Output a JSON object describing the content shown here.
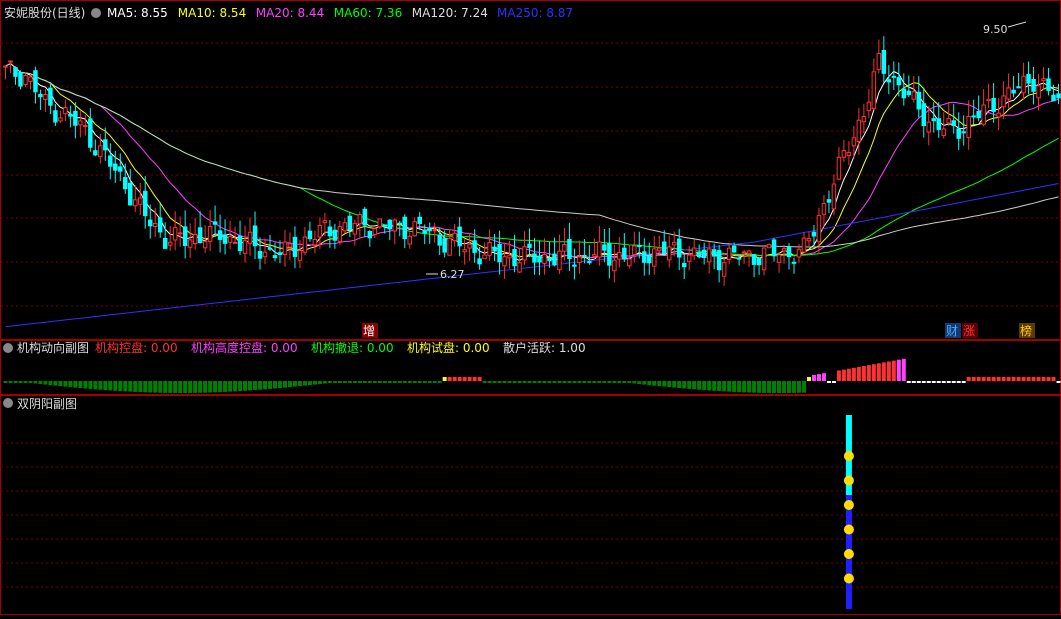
{
  "header": {
    "title": "安妮股份(日线)",
    "ma": [
      {
        "label": "MA5: 8.55",
        "color": "#ffffff"
      },
      {
        "label": "MA10: 8.54",
        "color": "#ffff00"
      },
      {
        "label": "MA20: 8.44",
        "color": "#ff40ff"
      },
      {
        "label": "MA60: 7.36",
        "color": "#00ff00"
      },
      {
        "label": "MA120: 7.24",
        "color": "#dddddd"
      },
      {
        "label": "MA250: 8.87",
        "color": "#3030ff"
      }
    ]
  },
  "annotations": {
    "high_label": "9.50",
    "low_label": "6.27",
    "tags": [
      {
        "text": "增",
        "color": "#ffffff"
      },
      {
        "text": "财",
        "color": "#4aa8ff"
      },
      {
        "text": "涨",
        "color": "#ff3030"
      },
      {
        "text": "榜",
        "color": "#ffcc00"
      }
    ]
  },
  "sub1": {
    "title": "机构动向副图",
    "items": [
      {
        "label": "机构控盘: 0.00",
        "color": "#ff3030"
      },
      {
        "label": "机构高度控盘: 0.00",
        "color": "#ff40ff"
      },
      {
        "label": "机构撤退: 0.00",
        "color": "#00ff00"
      },
      {
        "label": "机构试盘: 0.00",
        "color": "#ffff00"
      },
      {
        "label": "散户活跃: 1.00",
        "color": "#dddddd"
      }
    ]
  },
  "sub2": {
    "title": "双阴阳副图"
  },
  "colors": {
    "up": "#ff3030",
    "down": "#00ffff",
    "grid": "#7a0000",
    "border": "#a00000"
  },
  "chart_data": {
    "type": "candlestick",
    "count": 116,
    "price_range": [
      5.2,
      9.8
    ],
    "closes_keypoints": [
      [
        0,
        9.1
      ],
      [
        4,
        9.05
      ],
      [
        8,
        8.6
      ],
      [
        12,
        8.45
      ],
      [
        16,
        8.2
      ],
      [
        20,
        7.8
      ],
      [
        24,
        7.4
      ],
      [
        28,
        6.9
      ],
      [
        32,
        6.6
      ],
      [
        36,
        6.55
      ],
      [
        40,
        6.65
      ],
      [
        44,
        6.6
      ],
      [
        48,
        6.5
      ],
      [
        52,
        6.4
      ],
      [
        56,
        6.35
      ],
      [
        60,
        6.55
      ],
      [
        64,
        6.7
      ],
      [
        68,
        6.75
      ],
      [
        72,
        6.8
      ],
      [
        76,
        6.75
      ],
      [
        80,
        6.75
      ],
      [
        84,
        6.7
      ],
      [
        88,
        6.55
      ],
      [
        92,
        6.45
      ],
      [
        96,
        6.35
      ],
      [
        100,
        6.3
      ],
      [
        104,
        6.3
      ],
      [
        108,
        6.3
      ],
      [
        112,
        6.3
      ],
      [
        116,
        6.3
      ],
      [
        120,
        6.35
      ],
      [
        124,
        6.3
      ],
      [
        128,
        6.35
      ],
      [
        132,
        6.4
      ],
      [
        136,
        6.35
      ],
      [
        140,
        6.3
      ],
      [
        144,
        6.3
      ],
      [
        148,
        6.32
      ],
      [
        152,
        6.34
      ],
      [
        156,
        6.36
      ],
      [
        160,
        6.4
      ],
      [
        162,
        6.7
      ],
      [
        164,
        7.1
      ],
      [
        168,
        7.8
      ],
      [
        172,
        8.5
      ],
      [
        175,
        9.2
      ],
      [
        178,
        9.0
      ],
      [
        182,
        8.6
      ],
      [
        186,
        8.3
      ],
      [
        190,
        8.2
      ],
      [
        194,
        8.4
      ],
      [
        198,
        8.6
      ],
      [
        202,
        8.8
      ],
      [
        206,
        9.0
      ],
      [
        210,
        8.7
      ],
      [
        212,
        8.55
      ]
    ],
    "sub1_bars": {
      "colors_by_range": [
        {
          "range": [
            0,
            87
          ],
          "color": "#008000"
        },
        {
          "range": [
            88,
            88
          ],
          "color": "#ffff00"
        },
        {
          "range": [
            89,
            95
          ],
          "color": "#ff3030"
        },
        {
          "range": [
            96,
            160
          ],
          "color": "#008000"
        },
        {
          "range": [
            161,
            161
          ],
          "color": "#ffff00"
        },
        {
          "range": [
            162,
            164
          ],
          "color": "#ff40ff"
        },
        {
          "range": [
            167,
            178
          ],
          "color": "#ff3030"
        },
        {
          "range": [
            179,
            180
          ],
          "color": "#ff40ff"
        },
        {
          "range": [
            193,
            210
          ],
          "color": "#ff3030"
        }
      ]
    },
    "sub2_signal": {
      "bar_index": 169,
      "dots": 6
    }
  }
}
